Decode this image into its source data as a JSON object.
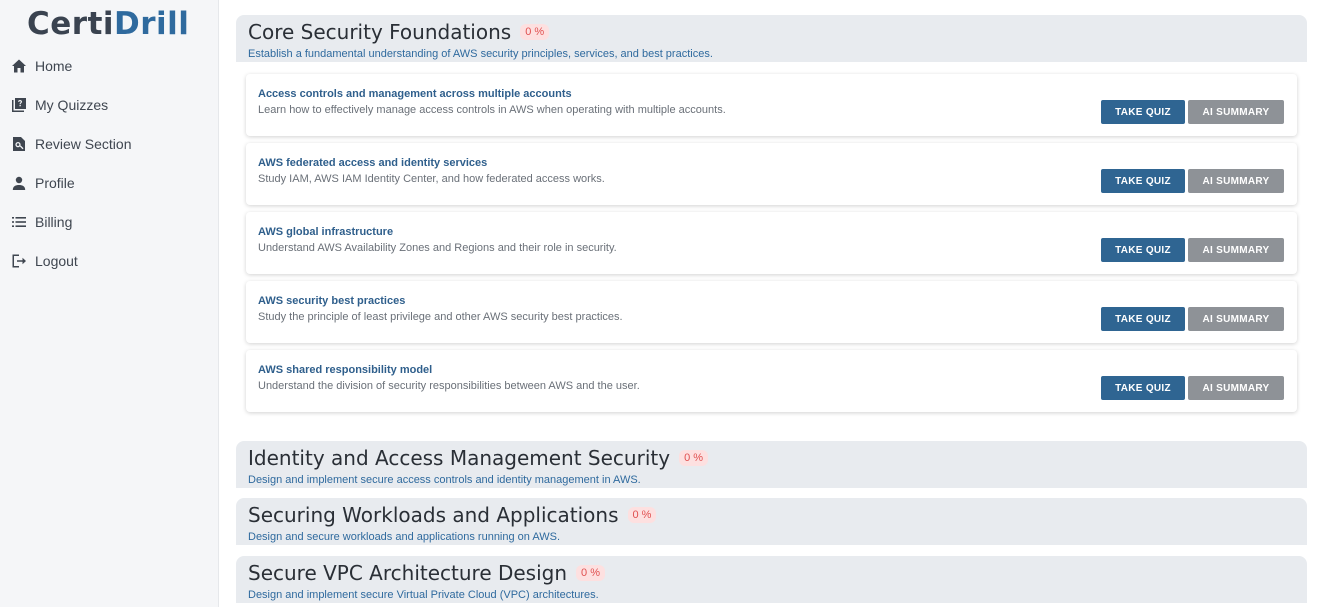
{
  "brand": {
    "part1": "Certi",
    "part2": "Drill"
  },
  "nav": [
    {
      "label": "Home",
      "icon": "home-icon"
    },
    {
      "label": "My Quizzes",
      "icon": "quiz-book-icon"
    },
    {
      "label": "Review Section",
      "icon": "review-search-icon"
    },
    {
      "label": "Profile",
      "icon": "person-icon"
    },
    {
      "label": "Billing",
      "icon": "list-icon"
    },
    {
      "label": "Logout",
      "icon": "logout-icon"
    }
  ],
  "sections": [
    {
      "title": "Core Security Foundations",
      "percent": "0 %",
      "description": "Establish a fundamental understanding of AWS security principles, services, and best practices."
    },
    {
      "title": "Identity and Access Management Security",
      "percent": "0 %",
      "description": "Design and implement secure access controls and identity management in AWS."
    },
    {
      "title": "Securing Workloads and Applications",
      "percent": "0 %",
      "description": "Design and secure workloads and applications running on AWS."
    },
    {
      "title": "Secure VPC Architecture Design",
      "percent": "0 %",
      "description": "Design and implement secure Virtual Private Cloud (VPC) architectures."
    }
  ],
  "topics": [
    {
      "title": "Access controls and management across multiple accounts",
      "description": "Learn how to effectively manage access controls in AWS when operating with multiple accounts."
    },
    {
      "title": "AWS federated access and identity services",
      "description": "Study IAM, AWS IAM Identity Center, and how federated access works."
    },
    {
      "title": "AWS global infrastructure",
      "description": "Understand AWS Availability Zones and Regions and their role in security."
    },
    {
      "title": "AWS security best practices",
      "description": "Study the principle of least privilege and other AWS security best practices."
    },
    {
      "title": "AWS shared responsibility model",
      "description": "Understand the division of security responsibilities between AWS and the user."
    }
  ],
  "buttons": {
    "take_quiz": "TAKE QUIZ",
    "ai_summary": "AI SUMMARY"
  },
  "colors": {
    "accent": "#2f6a9e",
    "button_primary": "#2f6592",
    "button_secondary": "#8e9297",
    "badge_bg": "#fde0e0",
    "badge_text": "#e05050"
  }
}
